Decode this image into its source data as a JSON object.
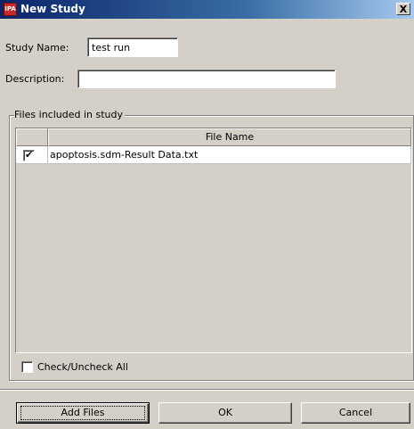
{
  "window": {
    "title": "New Study",
    "icon": "ipa-app-icon",
    "icon_text": "IPA",
    "close_label": "X"
  },
  "form": {
    "study_name_label": "Study Name:",
    "study_name_value": "test run",
    "description_label": "Description:",
    "description_value": ""
  },
  "files_group": {
    "legend": "Files included in study",
    "table": {
      "columns": [
        "",
        "File Name"
      ],
      "rows": [
        {
          "checked": true,
          "file_name": "apoptosis.sdm-Result Data.txt"
        }
      ]
    },
    "check_all_label": "Check/Uncheck All",
    "check_all_checked": false
  },
  "buttons": {
    "add_files": "Add Files",
    "ok": "OK",
    "cancel": "Cancel"
  },
  "colors": {
    "titlebar_start": "#0a246a",
    "titlebar_end": "#a6caf0",
    "face": "#d4d0c8"
  }
}
